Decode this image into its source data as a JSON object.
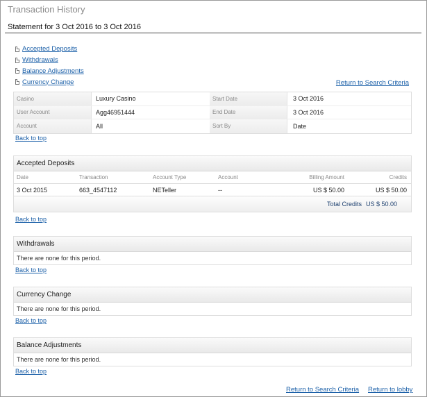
{
  "app": {
    "title": "Transaction History"
  },
  "statement": {
    "title": "Statement for 3 Oct 2016 to 3 Oct 2016"
  },
  "toc": {
    "items": [
      {
        "label": "Accepted Deposits"
      },
      {
        "label": "Withdrawals"
      },
      {
        "label": "Balance Adjustments"
      },
      {
        "label": "Currency Change"
      }
    ]
  },
  "links": {
    "return_to_search": "Return to Search Criteria",
    "back_to_top": "Back to top",
    "return_to_lobby": "Return to lobby"
  },
  "criteria": {
    "rows": [
      {
        "label1": "Casino",
        "value1": "Luxury Casino",
        "label2": "Start Date",
        "value2": "3 Oct 2016"
      },
      {
        "label1": "User Account",
        "value1": "Agg46951444",
        "label2": "End Date",
        "value2": "3 Oct 2016"
      },
      {
        "label1": "Account",
        "value1": "All",
        "label2": "Sort By",
        "value2": "Date"
      }
    ]
  },
  "deposits": {
    "title": "Accepted Deposits",
    "columns": [
      "Date",
      "Transaction",
      "Account Type",
      "Account",
      "Billing Amount",
      "Credits"
    ],
    "rows": [
      [
        "3 Oct 2015",
        "663_4547112",
        "NETeller",
        "--",
        "US $ 50.00",
        "US $ 50.00"
      ]
    ],
    "total_label": "Total Credits",
    "total_value": "US $ 50.00"
  },
  "withdrawals": {
    "title": "Withdrawals",
    "empty": "There are none for this period."
  },
  "currency_change": {
    "title": "Currency Change",
    "empty": "There are none for this period."
  },
  "balance_adjustments": {
    "title": "Balance Adjustments",
    "empty": "There are none for this period."
  },
  "icons": {
    "toc": "document-icon"
  }
}
